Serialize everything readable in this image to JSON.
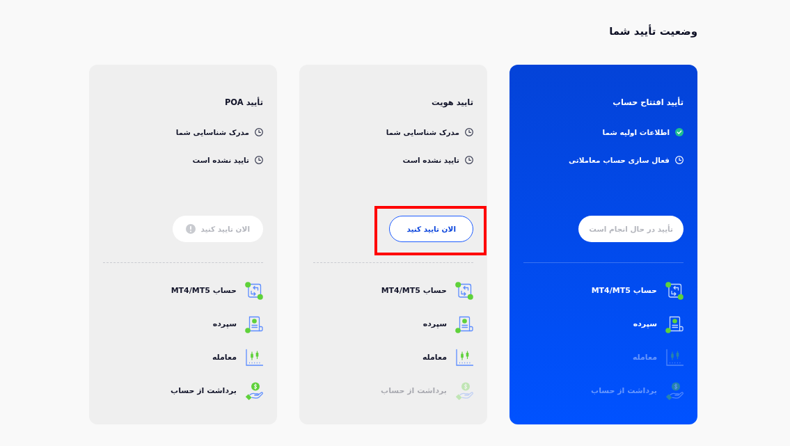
{
  "title": "وضعیت تأیید شما",
  "cards": [
    {
      "title": "تأیید افتتاح حساب",
      "current": true,
      "steps": [
        {
          "label": "اطلاعات اولیه شما",
          "done": true
        },
        {
          "label": "فعال سازی حساب معاملاتی",
          "done": false
        }
      ],
      "button": {
        "label": "تأیید در حال انجام است",
        "kind": "pending",
        "highlighted": false
      },
      "features": [
        {
          "kind": "account",
          "label": "حساب MT4/MT5",
          "disabled": false
        },
        {
          "kind": "deposit",
          "label": "سپرده",
          "disabled": false
        },
        {
          "kind": "trade",
          "label": "معامله",
          "disabled": true
        },
        {
          "kind": "withdraw",
          "label": "برداشت از حساب",
          "disabled": true
        }
      ]
    },
    {
      "title": "تایید هویت",
      "current": false,
      "steps": [
        {
          "label": "مدرک شناسایی شما",
          "done": false
        },
        {
          "label": "تایید نشده است",
          "done": false
        }
      ],
      "button": {
        "label": "الان تایید کنید",
        "kind": "ready",
        "highlighted": true
      },
      "features": [
        {
          "kind": "account",
          "label": "حساب MT4/MT5",
          "disabled": false
        },
        {
          "kind": "deposit",
          "label": "سپرده",
          "disabled": false
        },
        {
          "kind": "trade",
          "label": "معامله",
          "disabled": false
        },
        {
          "kind": "withdraw",
          "label": "برداشت از حساب",
          "disabled": true
        }
      ]
    },
    {
      "title": "تأیید POA",
      "current": false,
      "steps": [
        {
          "label": "مدرک شناسایی شما",
          "done": false
        },
        {
          "label": "تایید نشده است",
          "done": false
        }
      ],
      "button": {
        "label": "الان تایید کنید",
        "kind": "blocked",
        "highlighted": false
      },
      "features": [
        {
          "kind": "account",
          "label": "حساب MT4/MT5",
          "disabled": false
        },
        {
          "kind": "deposit",
          "label": "سپرده",
          "disabled": false
        },
        {
          "kind": "trade",
          "label": "معامله",
          "disabled": false
        },
        {
          "kind": "withdraw",
          "label": "برداشت از حساب",
          "disabled": false
        }
      ]
    }
  ]
}
